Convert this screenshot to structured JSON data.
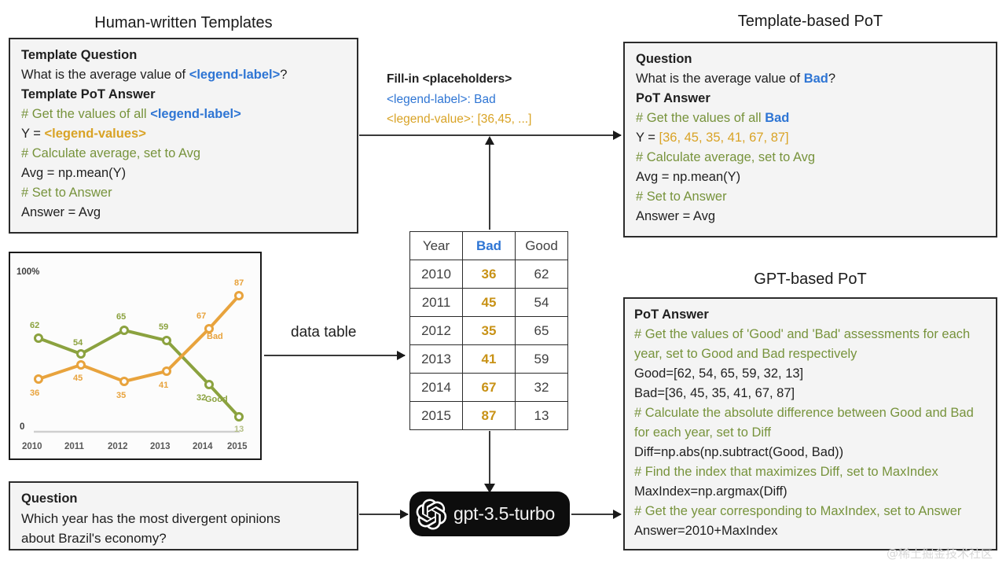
{
  "titles": {
    "human_templates": "Human-written Templates",
    "template_pot": "Template-based PoT",
    "gpt_pot": "GPT-based PoT"
  },
  "template_panel": {
    "question_heading": "Template Question",
    "question_prefix": "What is the average value of ",
    "question_placeholder": "<legend-label>",
    "question_suffix": "?",
    "answer_heading": "Template PoT Answer",
    "c1_prefix": "# Get the values of all ",
    "c1_placeholder": "<legend-label>",
    "y_prefix": "Y = ",
    "y_placeholder": "<legend-values>",
    "c2": "# Calculate average, set to Avg",
    "avg": "Avg = np.mean(Y)",
    "c3": "# Set to Answer",
    "answer": "Answer = Avg"
  },
  "fillin": {
    "heading": "Fill-in <placeholders>",
    "label_line": "<legend-label>: Bad",
    "value_line": "<legend-value>: [36,45, ...]"
  },
  "template_pot_panel": {
    "question_heading": "Question",
    "question_prefix": "What is the average value of ",
    "question_value": "Bad",
    "question_suffix": "?",
    "answer_heading": "PoT Answer",
    "c1_prefix": "# Get the values of all ",
    "c1_value": "Bad",
    "y_prefix": "Y = ",
    "y_value": "[36, 45, 35, 41, 67, 87]",
    "c2": "# Calculate average, set to Avg",
    "avg": "Avg = np.mean(Y)",
    "c3": "# Set to Answer",
    "answer": "Answer = Avg"
  },
  "gpt_pot_panel": {
    "answer_heading": "PoT  Answer",
    "c1": "# Get the values of 'Good' and 'Bad' assessments for each year, set to Good and Bad respectively",
    "good": "Good=[62, 54, 65, 59, 32, 13]",
    "bad": "Bad=[36, 45, 35, 41, 67, 87]",
    "c2": "# Calculate the absolute difference between Good and Bad for each year, set to Diff",
    "diff": "Diff=np.abs(np.subtract(Good, Bad))",
    "c3": "# Find the index that maximizes Diff, set to MaxIndex",
    "maxindex": "MaxIndex=np.argmax(Diff)",
    "c4": "# Get the year corresponding to MaxIndex, set to Answer",
    "answer": "Answer=2010+MaxIndex"
  },
  "question_panel": {
    "heading": "Question",
    "line1": "Which year has the most divergent opinions",
    "line2": "about Brazil's economy?"
  },
  "arrow_labels": {
    "data_table": "data table"
  },
  "model": {
    "name": "gpt-3.5-turbo"
  },
  "table": {
    "headers": [
      "Year",
      "Bad",
      "Good"
    ],
    "rows": [
      [
        "2010",
        "36",
        "62"
      ],
      [
        "2011",
        "45",
        "54"
      ],
      [
        "2012",
        "35",
        "65"
      ],
      [
        "2013",
        "41",
        "59"
      ],
      [
        "2014",
        "67",
        "32"
      ],
      [
        "2015",
        "87",
        "13"
      ]
    ]
  },
  "colors": {
    "blue": "#2e75d4",
    "gold": "#d9a326",
    "comment_green": "#77933c",
    "chart_bad": "#e8a33d",
    "chart_good": "#8ba23f",
    "panel_bg": "#f4f4f4"
  },
  "chart_data": {
    "type": "line",
    "title": "",
    "xlabel": "",
    "ylabel": "",
    "x": [
      "2010",
      "2011",
      "2012",
      "2013",
      "2014",
      "2015"
    ],
    "ylim": [
      0,
      100
    ],
    "y_top_label": "100%",
    "y_bottom_label": "0",
    "grid": false,
    "legend_position": "inline-right",
    "series": [
      {
        "name": "Good",
        "color": "#8ba23f",
        "values": [
          62,
          54,
          65,
          59,
          32,
          13
        ]
      },
      {
        "name": "Bad",
        "color": "#e8a33d",
        "values": [
          36,
          45,
          35,
          41,
          67,
          87
        ]
      }
    ]
  },
  "watermark": {
    "text": "@稀土掘金技术社区"
  }
}
